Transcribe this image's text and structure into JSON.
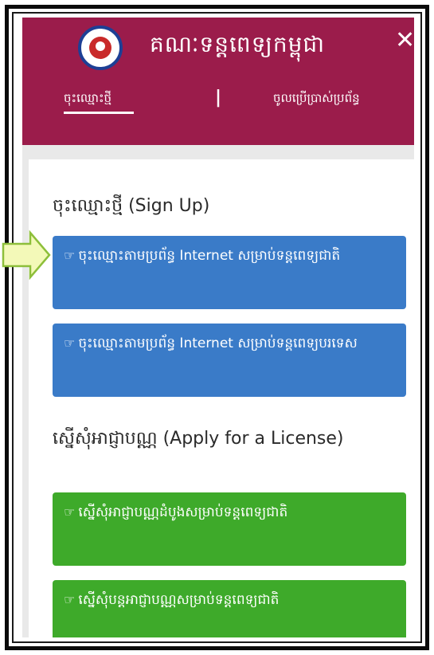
{
  "header": {
    "title": "គណៈទន្តពេទ្យកម្ពុជា",
    "close_glyph": "✕",
    "tabs": {
      "signup": "ចុះឈ្មោះថ្មី",
      "separator": "|",
      "login": "ចូលប្រើប្រាស់ប្រព័ន្ធ"
    }
  },
  "signup_section": {
    "title": "ចុះឈ្មោះថ្មី (Sign Up)",
    "buttons": [
      {
        "icon": "hand-pointer-icon",
        "label": "ចុះឈ្មោះតាមប្រព័ន្ធ Internet សម្រាប់ទន្តពេទ្យជាតិ"
      },
      {
        "icon": "hand-pointer-icon",
        "label": "ចុះឈ្មោះតាមប្រព័ន្ធ Internet សម្រាប់ទន្តពេទ្យបរទេស"
      }
    ]
  },
  "license_section": {
    "title": "ស្នើសុំអាជ្ញាបណ្ណ (Apply for a License)",
    "buttons": [
      {
        "icon": "hand-pointer-icon",
        "label": "ស្នើសុំអាជ្ញាបណ្ណដំបូងសម្រាប់ទន្តពេទ្យជាតិ"
      },
      {
        "icon": "hand-pointer-icon",
        "label": "ស្នើសុំបន្តអាជ្ញាបណ្ណសម្រាប់ទន្តពេទ្យជាតិ"
      }
    ]
  },
  "colors": {
    "header": "#9b1c4b",
    "blue_button": "#3a7bc8",
    "green_button": "#3eaa2a",
    "arrow_fill": "#f3f9b8",
    "arrow_stroke": "#8dbf3a"
  }
}
